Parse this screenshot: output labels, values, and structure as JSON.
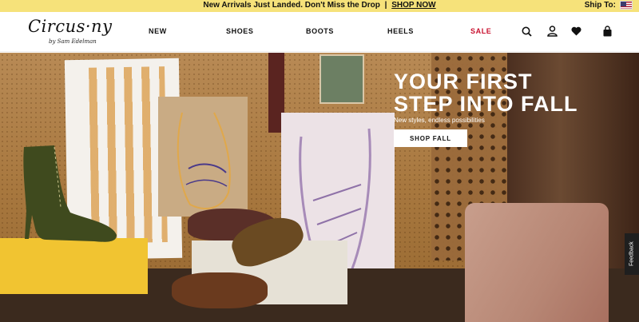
{
  "announcement": {
    "message": "New Arrivals Just Landed. Don't Miss the Drop",
    "separator": "|",
    "link": "SHOP NOW",
    "ship_to": "Ship To:"
  },
  "header": {
    "logo_main": "Circus·ny",
    "logo_sub": "by Sam Edelman",
    "nav": [
      "NEW",
      "SHOES",
      "BOOTS",
      "HEELS",
      "SALE"
    ],
    "icons": [
      "search-icon",
      "account-icon",
      "wishlist-heart-icon",
      "bag-icon"
    ],
    "sale_color": "#c8102e"
  },
  "hero": {
    "headline_line1": "YOUR FIRST",
    "headline_line2": "STEP INTO FALL",
    "subhead": "New styles, endless possibilities",
    "cta": "SHOP FALL"
  },
  "feedback": "Feedback",
  "colors": {
    "announcement_bg": "#f6e27a",
    "accent_sale": "#c8102e"
  }
}
